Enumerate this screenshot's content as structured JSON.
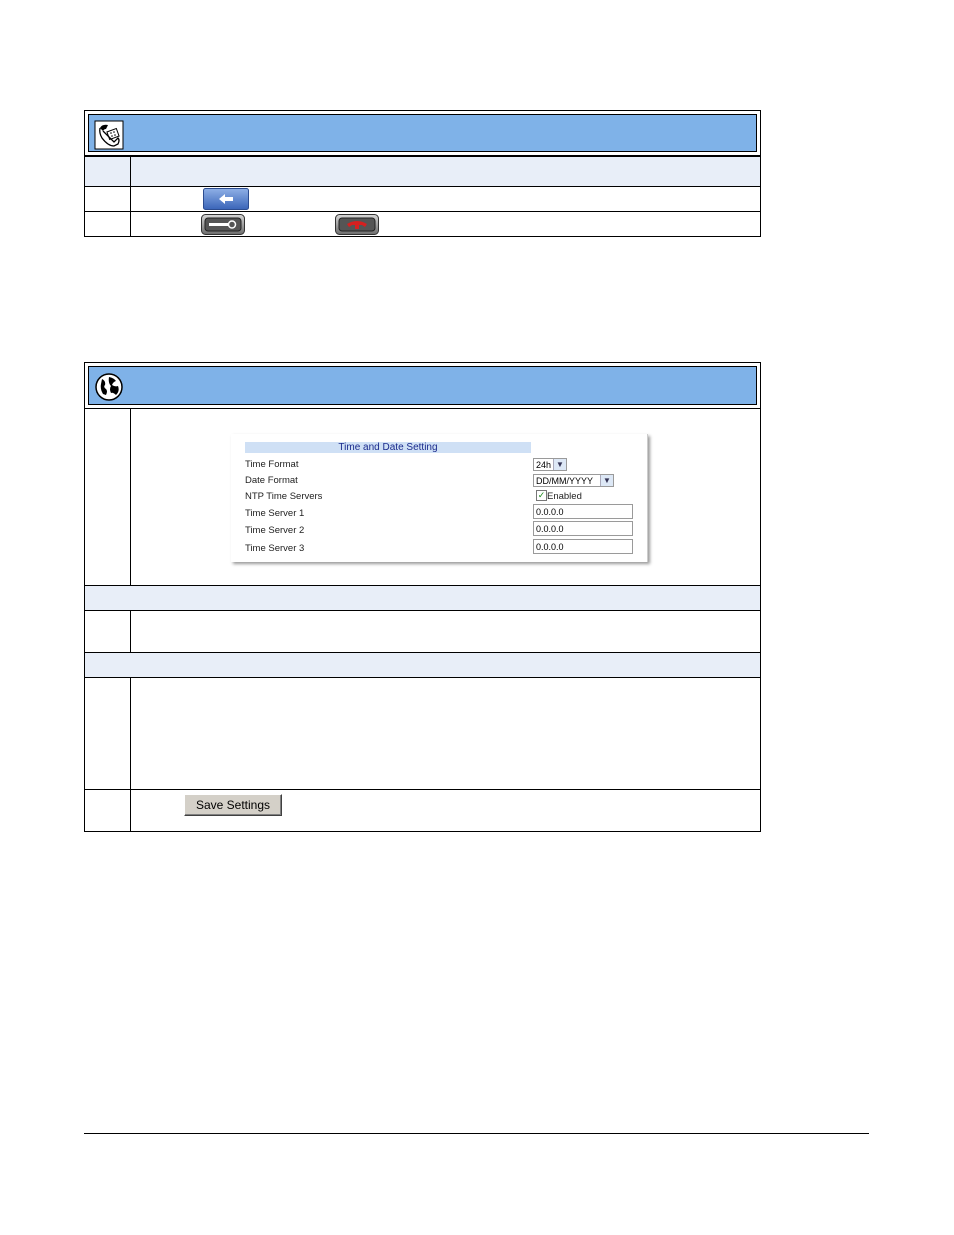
{
  "panel": {
    "title": "Time and Date Setting",
    "fields": {
      "time_format_label": "Time Format",
      "time_format_value": "24h",
      "date_format_label": "Date Format",
      "date_format_value": "DD/MM/YYYY",
      "ntp_label": "NTP Time Servers",
      "ntp_checkbox_label": "Enabled",
      "server1_label": "Time Server 1",
      "server1_value": "0.0.0.0",
      "server2_label": "Time Server 2",
      "server2_value": "0.0.0.0",
      "server3_label": "Time Server 3",
      "server3_value": "0.0.0.0"
    }
  },
  "save_button": {
    "label": "Save Settings"
  },
  "icons": {
    "phone_header": "phone-icon",
    "web_header": "globe-icon",
    "back_key": "left-arrow-key-icon",
    "options_key": "options-key-icon",
    "goodbye_key": "goodbye-key-icon"
  },
  "colors": {
    "header_blue": "#7fb2e8",
    "shade_row": "#e8eef8"
  }
}
